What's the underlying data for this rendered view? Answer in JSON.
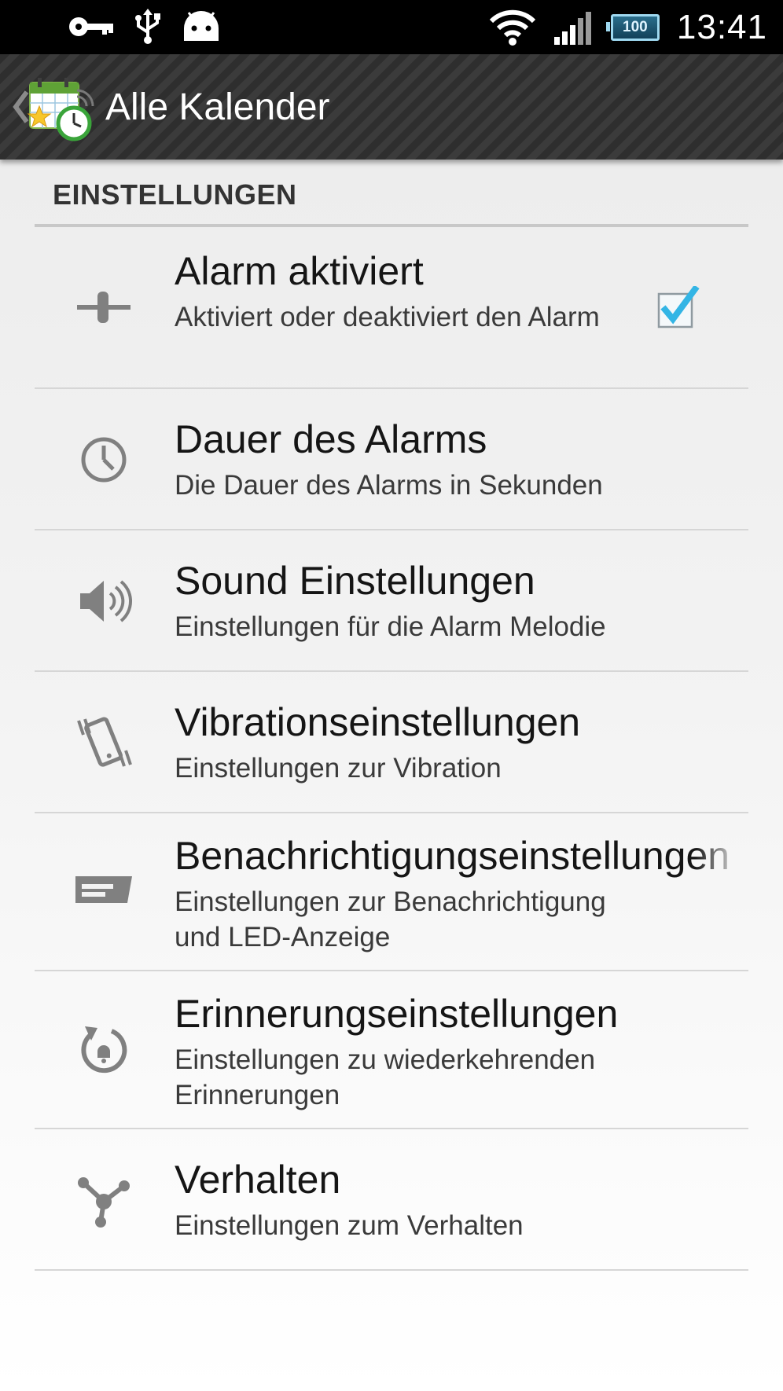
{
  "status_bar": {
    "time": "13:41",
    "battery": "100",
    "icons": [
      "key-icon",
      "usb-icon",
      "android-icon",
      "wifi-icon",
      "signal-icon",
      "battery-icon"
    ]
  },
  "action_bar": {
    "title": "Alle Kalender",
    "app_icon": "calendar-clock-icon"
  },
  "section": {
    "title": "EINSTELLUNGEN"
  },
  "preferences": [
    {
      "title": "Alarm aktiviert",
      "summary": "Aktiviert oder deaktiviert den Alarm",
      "icon": "toggle-switch-icon",
      "checked": true
    },
    {
      "title": "Dauer des Alarms",
      "summary": "Die Dauer des Alarms in Sekunden",
      "icon": "clock-icon"
    },
    {
      "title": "Sound Einstellungen",
      "summary": "Einstellungen für die Alarm Melodie",
      "icon": "speaker-icon"
    },
    {
      "title": "Vibrationseinstellungen",
      "summary": "Einstellungen zur Vibration",
      "icon": "vibrate-phone-icon"
    },
    {
      "title": "Benachrichtigungseinstellungen",
      "summary": "Einstellungen zur Benachrichtigung und LED-Anzeige",
      "icon": "notification-icon"
    },
    {
      "title": "Erinnerungseinstellungen",
      "summary": "Einstellungen zu wiederkehrenden Erinnerungen",
      "icon": "reminder-bell-icon"
    },
    {
      "title": "Verhalten",
      "summary": "Einstellungen zum Verhalten",
      "icon": "behavior-nodes-icon"
    }
  ],
  "colors": {
    "status_bar": "#000000",
    "action_bar": "#333333",
    "checkbox_accent": "#33b5e5",
    "icon_gray": "#808080"
  }
}
